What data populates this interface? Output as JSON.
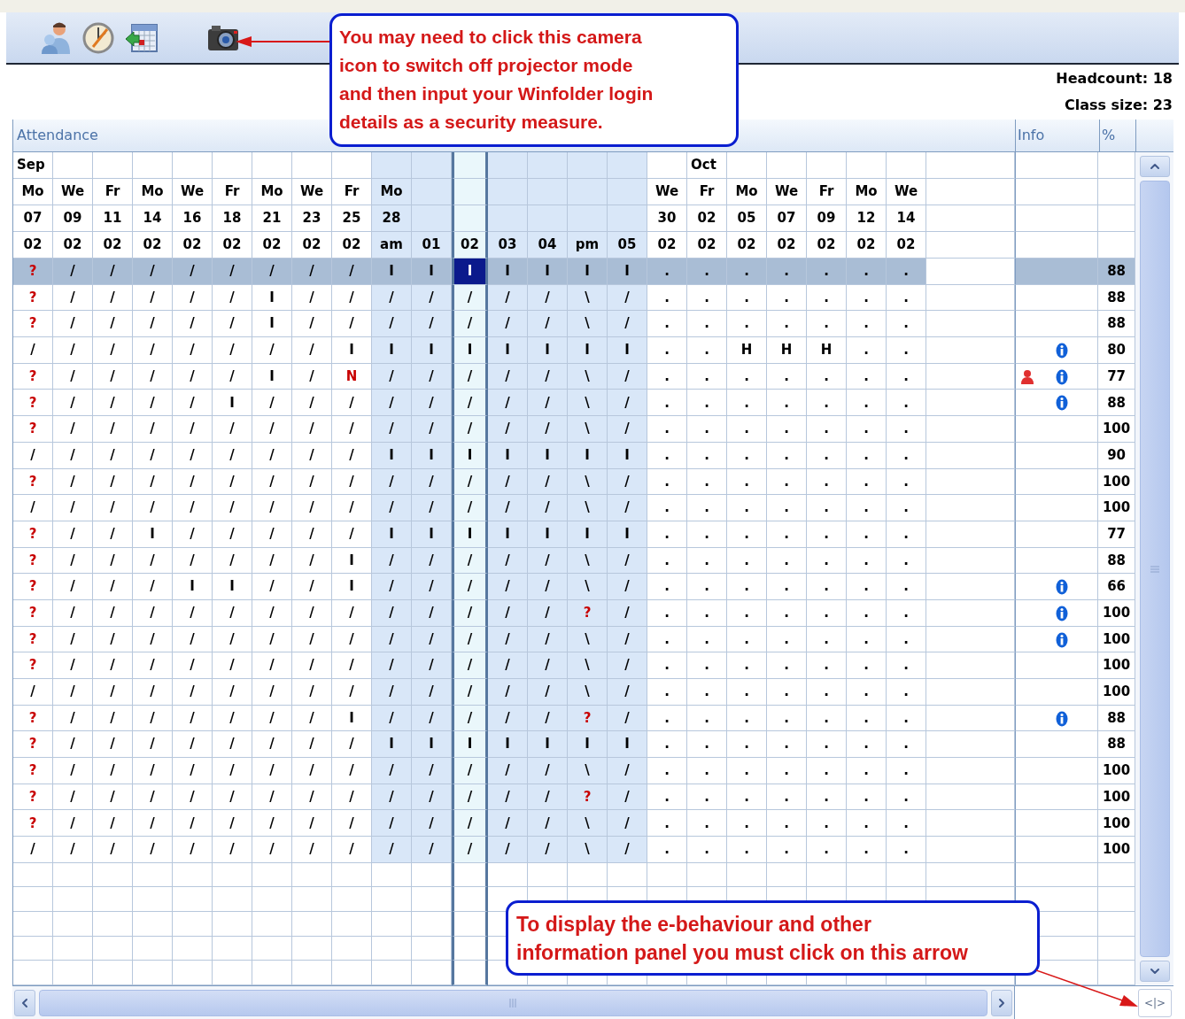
{
  "callouts": [
    {
      "lines": [
        "You may need to click this camera",
        "icon to switch off projector mode",
        "and then input your Winfolder login",
        "details as a security measure."
      ]
    },
    {
      "lines": [
        "To display the e-behaviour and other",
        "information panel you must click on this arrow"
      ]
    }
  ],
  "class_info": {
    "headcount": "Headcount: 18",
    "class_size": "Class size: 23"
  },
  "grid": {
    "title": "Attendance",
    "info_header": "Info",
    "percent_header": "%",
    "columns": [
      {
        "month": "Sep",
        "day": "Mo",
        "date": "07",
        "period": "02",
        "shaded": false,
        "selected": false
      },
      {
        "day": "We",
        "date": "09",
        "period": "02",
        "shaded": false,
        "selected": false
      },
      {
        "day": "Fr",
        "date": "11",
        "period": "02",
        "shaded": false,
        "selected": false
      },
      {
        "day": "Mo",
        "date": "14",
        "period": "02",
        "shaded": false,
        "selected": false
      },
      {
        "day": "We",
        "date": "16",
        "period": "02",
        "shaded": false,
        "selected": false
      },
      {
        "day": "Fr",
        "date": "18",
        "period": "02",
        "shaded": false,
        "selected": false
      },
      {
        "day": "Mo",
        "date": "21",
        "period": "02",
        "shaded": false,
        "selected": false
      },
      {
        "day": "We",
        "date": "23",
        "period": "02",
        "shaded": false,
        "selected": false
      },
      {
        "day": "Fr",
        "date": "25",
        "period": "02",
        "shaded": false,
        "selected": false
      },
      {
        "day": "Mo",
        "date": "28",
        "period": "am",
        "shaded": true,
        "selected": false
      },
      {
        "period": "01",
        "shaded": true,
        "selected": false
      },
      {
        "period": "02",
        "shaded": true,
        "selected": true
      },
      {
        "period": "03",
        "shaded": true,
        "selected": false
      },
      {
        "period": "04",
        "shaded": true,
        "selected": false
      },
      {
        "period": "pm",
        "shaded": true,
        "selected": false
      },
      {
        "period": "05",
        "shaded": true,
        "selected": false
      },
      {
        "day": "We",
        "date": "30",
        "period": "02",
        "shaded": false,
        "selected": false
      },
      {
        "month": "Oct",
        "day": "Fr",
        "date": "02",
        "period": "02",
        "shaded": false,
        "selected": false
      },
      {
        "day": "Mo",
        "date": "05",
        "period": "02",
        "shaded": false,
        "selected": false
      },
      {
        "day": "We",
        "date": "07",
        "period": "02",
        "shaded": false,
        "selected": false
      },
      {
        "day": "Fr",
        "date": "09",
        "period": "02",
        "shaded": false,
        "selected": false
      },
      {
        "day": "Mo",
        "date": "12",
        "period": "02",
        "shaded": false,
        "selected": false
      },
      {
        "day": "We",
        "date": "14",
        "period": "02",
        "shaded": false,
        "selected": false
      }
    ],
    "rows": [
      {
        "selected": true,
        "cells": [
          "?",
          "/",
          "/",
          "/",
          "/",
          "/",
          "/",
          "/",
          "/",
          "I",
          "I",
          "I",
          "I",
          "I",
          "I",
          "I",
          ".",
          ".",
          ".",
          ".",
          ".",
          ".",
          "."
        ],
        "alerts": [
          true,
          false,
          false,
          false,
          false,
          false,
          false,
          false,
          false,
          false,
          false,
          false,
          false,
          false,
          false,
          false,
          false,
          false,
          false,
          false,
          false,
          false,
          false
        ],
        "percent": "88"
      },
      {
        "selected": false,
        "cells": [
          "?",
          "/",
          "/",
          "/",
          "/",
          "/",
          "I",
          "/",
          "/",
          "/",
          "/",
          "/",
          "/",
          "/",
          "\\",
          "/",
          ".",
          ".",
          ".",
          ".",
          ".",
          ".",
          "."
        ],
        "alerts": [
          true,
          false,
          false,
          false,
          false,
          false,
          false,
          false,
          false,
          false,
          false,
          false,
          false,
          false,
          false,
          false,
          false,
          false,
          false,
          false,
          false,
          false,
          false
        ],
        "percent": "88"
      },
      {
        "selected": false,
        "cells": [
          "?",
          "/",
          "/",
          "/",
          "/",
          "/",
          "I",
          "/",
          "/",
          "/",
          "/",
          "/",
          "/",
          "/",
          "\\",
          "/",
          ".",
          ".",
          ".",
          ".",
          ".",
          ".",
          "."
        ],
        "alerts": [
          true,
          false,
          false,
          false,
          false,
          false,
          false,
          false,
          false,
          false,
          false,
          false,
          false,
          false,
          false,
          false,
          false,
          false,
          false,
          false,
          false,
          false,
          false
        ],
        "percent": "88"
      },
      {
        "selected": false,
        "cells": [
          "/",
          "/",
          "/",
          "/",
          "/",
          "/",
          "/",
          "/",
          "I",
          "I",
          "I",
          "I",
          "I",
          "I",
          "I",
          "I",
          ".",
          ".",
          "H",
          "H",
          "H",
          ".",
          "."
        ],
        "alerts": [
          false,
          false,
          false,
          false,
          false,
          false,
          false,
          false,
          false,
          false,
          false,
          false,
          false,
          false,
          false,
          false,
          false,
          false,
          false,
          false,
          false,
          false,
          false
        ],
        "info": [
          {
            "kind": "info"
          }
        ],
        "percent": "80"
      },
      {
        "selected": false,
        "cells": [
          "?",
          "/",
          "/",
          "/",
          "/",
          "/",
          "I",
          "/",
          "N",
          "/",
          "/",
          "/",
          "/",
          "/",
          "\\",
          "/",
          ".",
          ".",
          ".",
          ".",
          ".",
          ".",
          "."
        ],
        "alerts": [
          true,
          false,
          false,
          false,
          false,
          false,
          false,
          false,
          true,
          false,
          false,
          false,
          false,
          false,
          false,
          false,
          false,
          false,
          false,
          false,
          false,
          false,
          false
        ],
        "info": [
          {
            "kind": "person"
          },
          {
            "kind": "info"
          }
        ],
        "percent": "77"
      },
      {
        "selected": false,
        "cells": [
          "?",
          "/",
          "/",
          "/",
          "/",
          "I",
          "/",
          "/",
          "/",
          "/",
          "/",
          "/",
          "/",
          "/",
          "\\",
          "/",
          ".",
          ".",
          ".",
          ".",
          ".",
          ".",
          "."
        ],
        "alerts": [
          true,
          false,
          false,
          false,
          false,
          false,
          false,
          false,
          false,
          false,
          false,
          false,
          false,
          false,
          false,
          false,
          false,
          false,
          false,
          false,
          false,
          false,
          false
        ],
        "info": [
          {
            "kind": "info"
          }
        ],
        "percent": "88"
      },
      {
        "selected": false,
        "cells": [
          "?",
          "/",
          "/",
          "/",
          "/",
          "/",
          "/",
          "/",
          "/",
          "/",
          "/",
          "/",
          "/",
          "/",
          "\\",
          "/",
          ".",
          ".",
          ".",
          ".",
          ".",
          ".",
          "."
        ],
        "alerts": [
          true,
          false,
          false,
          false,
          false,
          false,
          false,
          false,
          false,
          false,
          false,
          false,
          false,
          false,
          false,
          false,
          false,
          false,
          false,
          false,
          false,
          false,
          false
        ],
        "percent": "100"
      },
      {
        "selected": false,
        "cells": [
          "/",
          "/",
          "/",
          "/",
          "/",
          "/",
          "/",
          "/",
          "/",
          "I",
          "I",
          "I",
          "I",
          "I",
          "I",
          "I",
          ".",
          ".",
          ".",
          ".",
          ".",
          ".",
          "."
        ],
        "alerts": [
          false,
          false,
          false,
          false,
          false,
          false,
          false,
          false,
          false,
          false,
          false,
          false,
          false,
          false,
          false,
          false,
          false,
          false,
          false,
          false,
          false,
          false,
          false
        ],
        "percent": "90"
      },
      {
        "selected": false,
        "cells": [
          "?",
          "/",
          "/",
          "/",
          "/",
          "/",
          "/",
          "/",
          "/",
          "/",
          "/",
          "/",
          "/",
          "/",
          "\\",
          "/",
          ".",
          ".",
          ".",
          ".",
          ".",
          ".",
          "."
        ],
        "alerts": [
          true,
          false,
          false,
          false,
          false,
          false,
          false,
          false,
          false,
          false,
          false,
          false,
          false,
          false,
          false,
          false,
          false,
          false,
          false,
          false,
          false,
          false,
          false
        ],
        "percent": "100"
      },
      {
        "selected": false,
        "cells": [
          "/",
          "/",
          "/",
          "/",
          "/",
          "/",
          "/",
          "/",
          "/",
          "/",
          "/",
          "/",
          "/",
          "/",
          "\\",
          "/",
          ".",
          ".",
          ".",
          ".",
          ".",
          ".",
          "."
        ],
        "alerts": [
          false,
          false,
          false,
          false,
          false,
          false,
          false,
          false,
          false,
          false,
          false,
          false,
          false,
          false,
          false,
          false,
          false,
          false,
          false,
          false,
          false,
          false,
          false
        ],
        "percent": "100"
      },
      {
        "selected": false,
        "cells": [
          "?",
          "/",
          "/",
          "I",
          "/",
          "/",
          "/",
          "/",
          "/",
          "I",
          "I",
          "I",
          "I",
          "I",
          "I",
          "I",
          ".",
          ".",
          ".",
          ".",
          ".",
          ".",
          "."
        ],
        "alerts": [
          true,
          false,
          false,
          false,
          false,
          false,
          false,
          false,
          false,
          false,
          false,
          false,
          false,
          false,
          false,
          false,
          false,
          false,
          false,
          false,
          false,
          false,
          false
        ],
        "percent": "77"
      },
      {
        "selected": false,
        "cells": [
          "?",
          "/",
          "/",
          "/",
          "/",
          "/",
          "/",
          "/",
          "I",
          "/",
          "/",
          "/",
          "/",
          "/",
          "\\",
          "/",
          ".",
          ".",
          ".",
          ".",
          ".",
          ".",
          "."
        ],
        "alerts": [
          true,
          false,
          false,
          false,
          false,
          false,
          false,
          false,
          false,
          false,
          false,
          false,
          false,
          false,
          false,
          false,
          false,
          false,
          false,
          false,
          false,
          false,
          false
        ],
        "percent": "88"
      },
      {
        "selected": false,
        "cells": [
          "?",
          "/",
          "/",
          "/",
          "I",
          "I",
          "/",
          "/",
          "I",
          "/",
          "/",
          "/",
          "/",
          "/",
          "\\",
          "/",
          ".",
          ".",
          ".",
          ".",
          ".",
          ".",
          "."
        ],
        "alerts": [
          true,
          false,
          false,
          false,
          false,
          false,
          false,
          false,
          false,
          false,
          false,
          false,
          false,
          false,
          false,
          false,
          false,
          false,
          false,
          false,
          false,
          false,
          false
        ],
        "info": [
          {
            "kind": "info"
          }
        ],
        "percent": "66"
      },
      {
        "selected": false,
        "cells": [
          "?",
          "/",
          "/",
          "/",
          "/",
          "/",
          "/",
          "/",
          "/",
          "/",
          "/",
          "/",
          "/",
          "/",
          "?",
          "/",
          ".",
          ".",
          ".",
          ".",
          ".",
          ".",
          "."
        ],
        "alerts": [
          true,
          false,
          false,
          false,
          false,
          false,
          false,
          false,
          false,
          false,
          false,
          false,
          false,
          false,
          true,
          false,
          false,
          false,
          false,
          false,
          false,
          false,
          false
        ],
        "info": [
          {
            "kind": "info"
          }
        ],
        "percent": "100"
      },
      {
        "selected": false,
        "cells": [
          "?",
          "/",
          "/",
          "/",
          "/",
          "/",
          "/",
          "/",
          "/",
          "/",
          "/",
          "/",
          "/",
          "/",
          "\\",
          "/",
          ".",
          ".",
          ".",
          ".",
          ".",
          ".",
          "."
        ],
        "alerts": [
          true,
          false,
          false,
          false,
          false,
          false,
          false,
          false,
          false,
          false,
          false,
          false,
          false,
          false,
          false,
          false,
          false,
          false,
          false,
          false,
          false,
          false,
          false
        ],
        "info": [
          {
            "kind": "info"
          }
        ],
        "percent": "100"
      },
      {
        "selected": false,
        "cells": [
          "?",
          "/",
          "/",
          "/",
          "/",
          "/",
          "/",
          "/",
          "/",
          "/",
          "/",
          "/",
          "/",
          "/",
          "\\",
          "/",
          ".",
          ".",
          ".",
          ".",
          ".",
          ".",
          "."
        ],
        "alerts": [
          true,
          false,
          false,
          false,
          false,
          false,
          false,
          false,
          false,
          false,
          false,
          false,
          false,
          false,
          false,
          false,
          false,
          false,
          false,
          false,
          false,
          false,
          false
        ],
        "percent": "100"
      },
      {
        "selected": false,
        "cells": [
          "/",
          "/",
          "/",
          "/",
          "/",
          "/",
          "/",
          "/",
          "/",
          "/",
          "/",
          "/",
          "/",
          "/",
          "\\",
          "/",
          ".",
          ".",
          ".",
          ".",
          ".",
          ".",
          "."
        ],
        "alerts": [
          false,
          false,
          false,
          false,
          false,
          false,
          false,
          false,
          false,
          false,
          false,
          false,
          false,
          false,
          false,
          false,
          false,
          false,
          false,
          false,
          false,
          false,
          false
        ],
        "percent": "100"
      },
      {
        "selected": false,
        "cells": [
          "?",
          "/",
          "/",
          "/",
          "/",
          "/",
          "/",
          "/",
          "I",
          "/",
          "/",
          "/",
          "/",
          "/",
          "?",
          "/",
          ".",
          ".",
          ".",
          ".",
          ".",
          ".",
          "."
        ],
        "alerts": [
          true,
          false,
          false,
          false,
          false,
          false,
          false,
          false,
          false,
          false,
          false,
          false,
          false,
          false,
          true,
          false,
          false,
          false,
          false,
          false,
          false,
          false,
          false
        ],
        "info": [
          {
            "kind": "info"
          }
        ],
        "percent": "88"
      },
      {
        "selected": false,
        "cells": [
          "?",
          "/",
          "/",
          "/",
          "/",
          "/",
          "/",
          "/",
          "/",
          "I",
          "I",
          "I",
          "I",
          "I",
          "I",
          "I",
          ".",
          ".",
          ".",
          ".",
          ".",
          ".",
          "."
        ],
        "alerts": [
          true,
          false,
          false,
          false,
          false,
          false,
          false,
          false,
          false,
          false,
          false,
          false,
          false,
          false,
          false,
          false,
          false,
          false,
          false,
          false,
          false,
          false,
          false
        ],
        "percent": "88"
      },
      {
        "selected": false,
        "cells": [
          "?",
          "/",
          "/",
          "/",
          "/",
          "/",
          "/",
          "/",
          "/",
          "/",
          "/",
          "/",
          "/",
          "/",
          "\\",
          "/",
          ".",
          ".",
          ".",
          ".",
          ".",
          ".",
          "."
        ],
        "alerts": [
          true,
          false,
          false,
          false,
          false,
          false,
          false,
          false,
          false,
          false,
          false,
          false,
          false,
          false,
          false,
          false,
          false,
          false,
          false,
          false,
          false,
          false,
          false
        ],
        "percent": "100"
      },
      {
        "selected": false,
        "cells": [
          "?",
          "/",
          "/",
          "/",
          "/",
          "/",
          "/",
          "/",
          "/",
          "/",
          "/",
          "/",
          "/",
          "/",
          "?",
          "/",
          ".",
          ".",
          ".",
          ".",
          ".",
          ".",
          "."
        ],
        "alerts": [
          true,
          false,
          false,
          false,
          false,
          false,
          false,
          false,
          false,
          false,
          false,
          false,
          false,
          false,
          true,
          false,
          false,
          false,
          false,
          false,
          false,
          false,
          false
        ],
        "percent": "100"
      },
      {
        "selected": false,
        "cells": [
          "?",
          "/",
          "/",
          "/",
          "/",
          "/",
          "/",
          "/",
          "/",
          "/",
          "/",
          "/",
          "/",
          "/",
          "\\",
          "/",
          ".",
          ".",
          ".",
          ".",
          ".",
          ".",
          "."
        ],
        "alerts": [
          true,
          false,
          false,
          false,
          false,
          false,
          false,
          false,
          false,
          false,
          false,
          false,
          false,
          false,
          false,
          false,
          false,
          false,
          false,
          false,
          false,
          false,
          false
        ],
        "percent": "100"
      },
      {
        "selected": false,
        "cells": [
          "/",
          "/",
          "/",
          "/",
          "/",
          "/",
          "/",
          "/",
          "/",
          "/",
          "/",
          "/",
          "/",
          "/",
          "\\",
          "/",
          ".",
          ".",
          ".",
          ".",
          ".",
          ".",
          "."
        ],
        "alerts": [
          false,
          false,
          false,
          false,
          false,
          false,
          false,
          false,
          false,
          false,
          false,
          false,
          false,
          false,
          false,
          false,
          false,
          false,
          false,
          false,
          false,
          false,
          false
        ],
        "percent": "100"
      }
    ]
  },
  "panel_toggle": "<|>"
}
